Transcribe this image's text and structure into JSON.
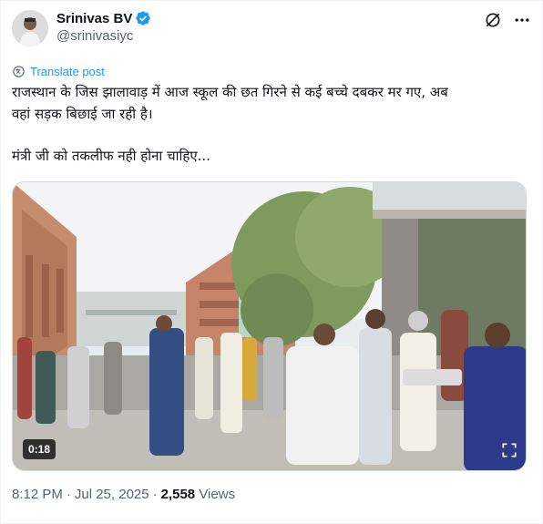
{
  "author": {
    "name": "Srinivas BV",
    "handle": "@srinivasiyc",
    "verified": true,
    "avatar_icon": "profile-photo"
  },
  "header_actions": {
    "grok_icon": "grok-slash-icon",
    "more_icon": "more-dots-icon"
  },
  "translate": {
    "icon": "translate-icon",
    "label": "Translate post"
  },
  "tweet": {
    "line1": "राजस्थान के जिस झालावाड़ में आज स्कूल की छत गिरने से कई बच्चे दबकर मर गए, अब",
    "line2": "वहां  सड़क बिछाई जा रही है।",
    "line3": "मंत्री जी को तकलीफ नही होना चाहिए..."
  },
  "video": {
    "timecode": "0:18",
    "description_icon": "video-thumbnail"
  },
  "meta": {
    "time": "8:12 PM",
    "date": "Jul 25, 2025",
    "views_count": "2,558",
    "views_label": "Views",
    "separator": "·"
  },
  "colors": {
    "text": "#0f1419",
    "secondary": "#536471",
    "link": "#1d9bf0",
    "verified": "#1d9bf0"
  }
}
